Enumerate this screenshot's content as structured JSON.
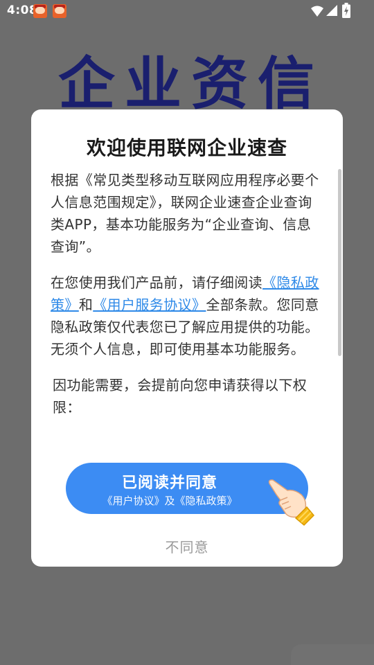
{
  "status_bar": {
    "time": "4:08",
    "notification_icons": [
      "game-notification-icon",
      "game-notification-icon"
    ],
    "system_icons": [
      "wifi-icon",
      "signal-icon",
      "battery-charging-icon"
    ]
  },
  "background": {
    "logo_text": "企业资信",
    "logo_color": "#1a1f6e"
  },
  "dialog": {
    "title": "欢迎使用联网企业速查",
    "paragraph_1": "根据《常见类型移动互联网应用程序必要个人信息范围规定》，联网企业速查企业查询类APP，基本功能服务为“企业查询、信息查询”。",
    "paragraph_2": {
      "prefix": "在您使用我们产品前，请仔细阅读",
      "privacy_link": "《隐私政策》",
      "and": "和",
      "agreement_link": "《用户服务协议》",
      "suffix": "全部条款。您同意隐私政策仅代表您已了解应用提供的功能。无须个人信息，即可使用基本功能服务。"
    },
    "paragraph_3": "因功能需要，会提前向您申请获得以下权限：",
    "agree_button": {
      "label": "已阅读并同意",
      "sublabel": "《用户协议》及《隐私政策》",
      "icon": "pointing-hand-icon"
    },
    "disagree_label": "不同意"
  },
  "colors": {
    "overlay": "#6d6d6d",
    "primary_button": "#3c8cf3",
    "link": "#2f8ae8",
    "disagree_text": "#9a9a9a"
  }
}
